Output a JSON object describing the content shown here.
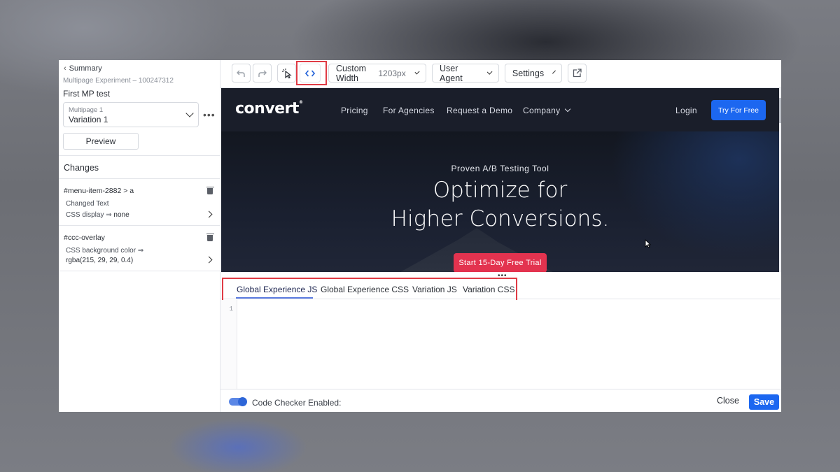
{
  "sidebar": {
    "back_label": "Summary",
    "experiment_id": "Multipage Experiment – 100247312",
    "experiment_name": "First MP test",
    "variation_select": {
      "page": "Multipage 1",
      "variation": "Variation 1"
    },
    "more_icon": "more-horizontal-icon",
    "preview_label": "Preview",
    "changes_title": "Changes",
    "changes": [
      {
        "selector": "#menu-item-2882 > a",
        "line1": "Changed Text",
        "line2_prefix": "CSS display ⇒ ",
        "line2_value": "none"
      },
      {
        "selector": "#ccc-overlay",
        "line1": "CSS background color ⇒",
        "line2_prefix": "",
        "line2_value": "rgba(215, 29, 29, 0.4)"
      }
    ]
  },
  "toolbar": {
    "undo_icon": "undo-icon",
    "redo_icon": "redo-icon",
    "select_icon": "cursor-select-icon",
    "code_icon": "code-brackets-icon",
    "width_label": "Custom Width",
    "width_value": "1203px",
    "user_agent_label": "User Agent",
    "settings_label": "Settings",
    "external_icon": "open-external-icon"
  },
  "site": {
    "logo": "convert",
    "nav": [
      "Pricing",
      "For Agencies",
      "Request a Demo",
      "Company"
    ],
    "login": "Login",
    "try_button": "Try For Free",
    "kicker": "Proven A/B Testing Tool",
    "title_line1": "Optimize for",
    "title_line2": "Higher Conversions.",
    "cta": "Start 15-Day Free Trial"
  },
  "code_panel": {
    "tabs": [
      "Global Experience JS",
      "Global Experience CSS",
      "Variation JS",
      "Variation CSS"
    ],
    "active_tab": "Global Experience JS",
    "line_number": "1"
  },
  "footer": {
    "code_checker_label": "Code Checker Enabled:",
    "close_label": "Close",
    "save_label": "Save"
  },
  "colors": {
    "accent_blue": "#1c67f0",
    "highlight_red": "#e03b45",
    "cta_pink": "#e3334f",
    "site_dark": "#191d29"
  }
}
